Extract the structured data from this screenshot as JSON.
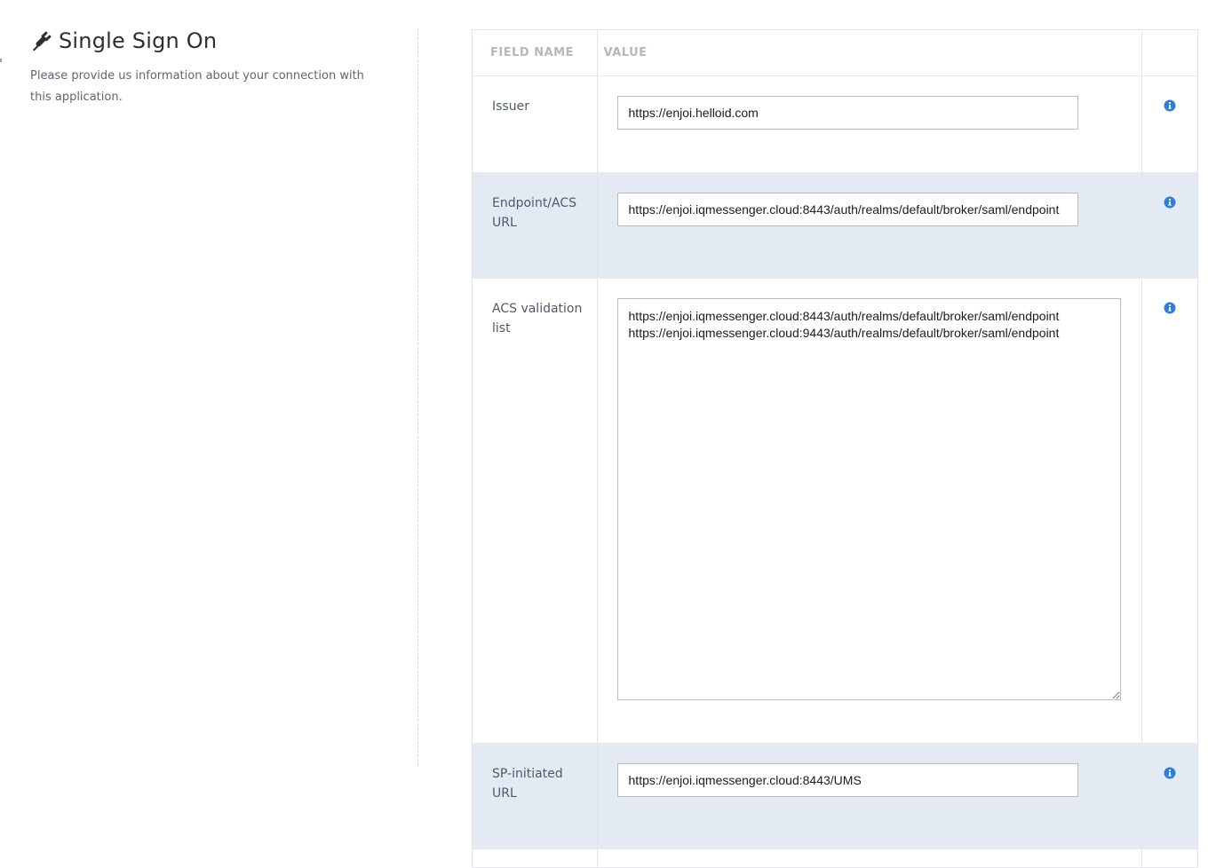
{
  "header": {
    "title": "Single Sign On",
    "description": "Please provide us information about your connection with this application.",
    "icon": "plug-icon"
  },
  "table": {
    "columns": {
      "field_name": "FIELD NAME",
      "value": "VALUE"
    },
    "rows": [
      {
        "label": "Issuer",
        "value": "https://enjoi.helloid.com"
      },
      {
        "label": "Endpoint/ACS URL",
        "value": "https://enjoi.iqmessenger.cloud:8443/auth/realms/default/broker/saml/endpoint"
      },
      {
        "label": "ACS validation list",
        "value": "https://enjoi.iqmessenger.cloud:8443/auth/realms/default/broker/saml/endpoint\nhttps://enjoi.iqmessenger.cloud:9443/auth/realms/default/broker/saml/endpoint"
      },
      {
        "label": "SP-initiated URL",
        "value": "https://enjoi.iqmessenger.cloud:8443/UMS"
      }
    ]
  },
  "colors": {
    "accent_blue": "#2f7fd6",
    "row_highlight": "#e3eaf3",
    "header_text": "#b3b8bd"
  }
}
